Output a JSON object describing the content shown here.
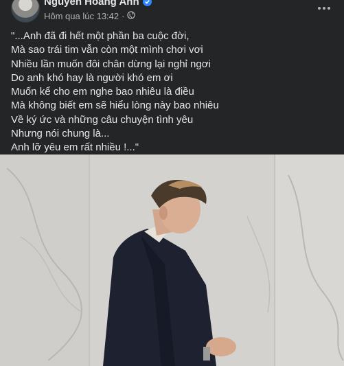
{
  "post": {
    "author": "Nguyễn Hoàng Anh",
    "timestamp": "Hôm qua lúc 13:42",
    "privacy_icon": "public-globe-icon",
    "verified_icon": "verified-badge-icon",
    "more_icon": "more-options-icon",
    "lines": [
      "\"...Anh đã đi hết một phần ba cuộc đời,",
      "Mà sao trái tim vẫn còn một mình chơi vơi",
      "Nhiều lần muốn đôi chân dừng lại nghỉ ngơi",
      "Do anh khó hay là người khó em ơi",
      "Muốn kể cho em nghe bao nhiêu là điều",
      "Mà không biết em sẽ hiểu lòng này bao nhiêu",
      "Về ký ức và những câu chuyện tình yêu",
      "Nhưng nói chung là...",
      "Anh lỡ yêu em rất nhiều !...\""
    ]
  },
  "colors": {
    "background": "#242526",
    "text_primary": "#e4e6eb",
    "text_secondary": "#b0b3b8",
    "verified_blue": "#2d88ff"
  }
}
